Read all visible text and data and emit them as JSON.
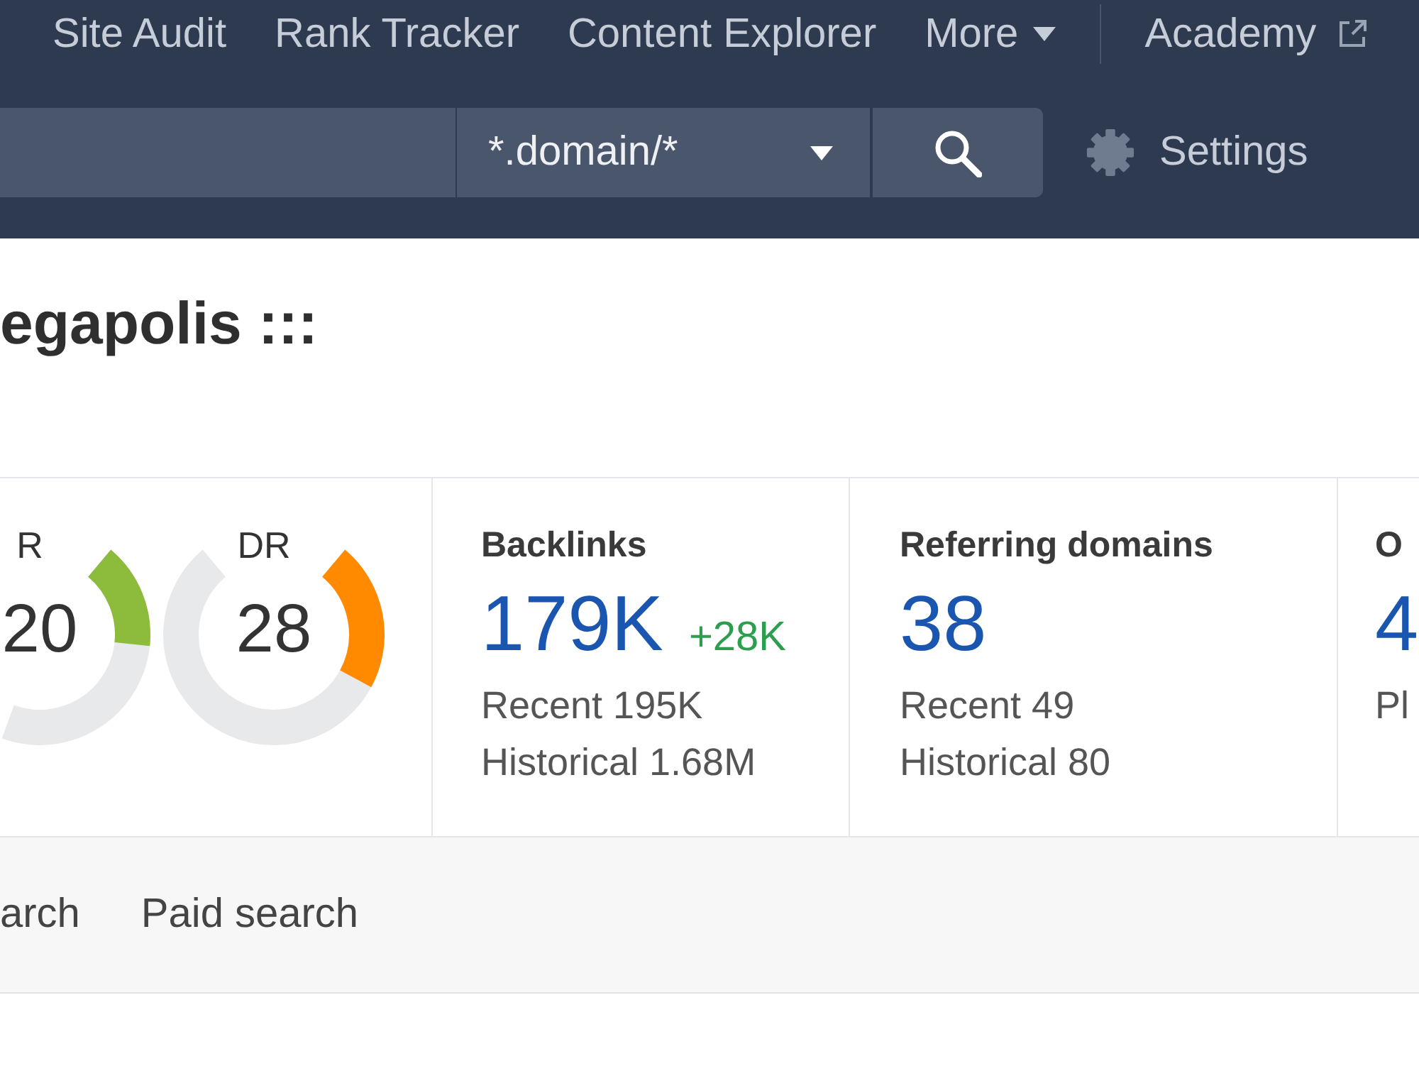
{
  "nav": {
    "items": [
      {
        "label": "Site Audit",
        "kind": "link",
        "selected": false
      },
      {
        "label": "Rank Tracker",
        "kind": "link",
        "selected": false
      },
      {
        "label": "Content Explorer",
        "kind": "link",
        "selected": false
      },
      {
        "label": "More",
        "kind": "dropdown",
        "selected": false
      }
    ],
    "academy": "Academy"
  },
  "search": {
    "mode": "*.domain/*",
    "settings": "Settings"
  },
  "page_title": "egapolis :::",
  "metrics": [
    {
      "kind": "gauges",
      "gauges": [
        {
          "label": "R",
          "value": "20",
          "color": "#8dbb3c"
        },
        {
          "label": "DR",
          "value": "28",
          "color": "#ff8a00"
        }
      ]
    },
    {
      "kind": "stat",
      "label": "Backlinks",
      "value": "179K",
      "delta": "+28K",
      "details": [
        "Recent 195K",
        "Historical 1.68M"
      ]
    },
    {
      "kind": "stat",
      "label": "Referring domains",
      "value": "38",
      "details": [
        "Recent 49",
        "Historical 80"
      ]
    },
    {
      "kind": "stat",
      "label": "O",
      "value": "4",
      "details": [
        "Pl"
      ]
    }
  ],
  "tabs": [
    {
      "label": "arch",
      "selected": false
    },
    {
      "label": "Paid search",
      "selected": false
    }
  ]
}
